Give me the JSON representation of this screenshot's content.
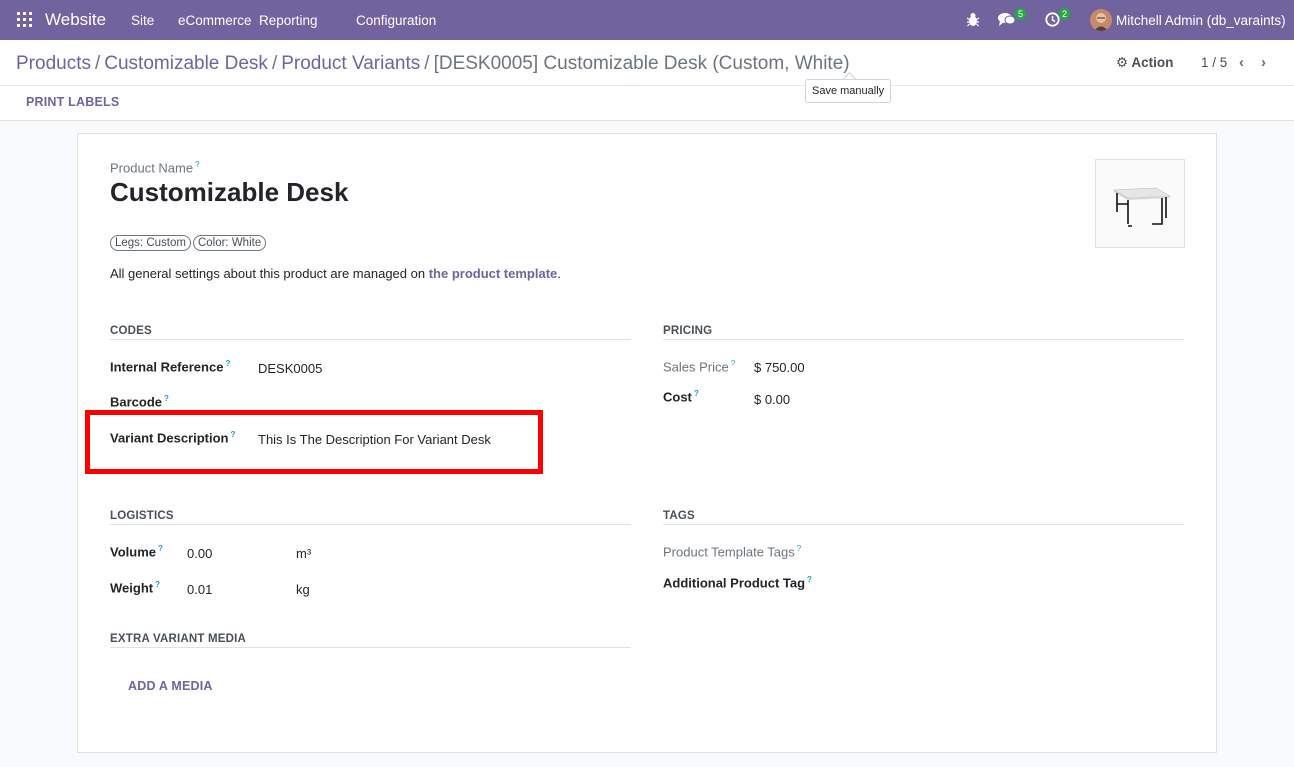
{
  "navbar": {
    "brand": "Website",
    "menu": [
      "Site",
      "eCommerce",
      "Reporting",
      "Configuration"
    ],
    "messages_count": "5",
    "activities_count": "2",
    "user": "Mitchell Admin (db_varaints)"
  },
  "breadcrumb": {
    "items": [
      "Products",
      "Customizable Desk",
      "Product Variants"
    ],
    "current": "[DESK0005] Customizable Desk (Custom, White)"
  },
  "control": {
    "action_label": "Action",
    "pager": "1 / 5",
    "print_labels": "PRINT LABELS",
    "tooltip": "Save manually"
  },
  "product": {
    "name_label": "Product Name",
    "name": "Customizable Desk",
    "attributes": [
      "Legs: Custom",
      "Color: White"
    ],
    "info_text": "All general settings about this product are managed on ",
    "info_link": "the product template",
    "info_end": "."
  },
  "codes": {
    "heading": "CODES",
    "internal_ref_label": "Internal Reference",
    "internal_ref_value": "DESK0005",
    "barcode_label": "Barcode",
    "barcode_value": "",
    "variant_desc_label": "Variant Description",
    "variant_desc_value": "This Is The Description For Variant Desk"
  },
  "pricing": {
    "heading": "PRICING",
    "sales_price_label": "Sales Price",
    "sales_price_value": "$ 750.00",
    "cost_label": "Cost",
    "cost_value": "$ 0.00"
  },
  "logistics": {
    "heading": "LOGISTICS",
    "volume_label": "Volume",
    "volume_value": "0.00",
    "volume_unit": "m³",
    "weight_label": "Weight",
    "weight_value": "0.01",
    "weight_unit": "kg"
  },
  "tags": {
    "heading": "TAGS",
    "template_tags_label": "Product Template Tags",
    "additional_tag_label": "Additional Product Tag"
  },
  "media": {
    "heading": "EXTRA VARIANT MEDIA",
    "add_label": "ADD A MEDIA"
  },
  "colors": {
    "brand": "#71639e",
    "highlight": "#ff0000",
    "badge": "#28a745"
  }
}
